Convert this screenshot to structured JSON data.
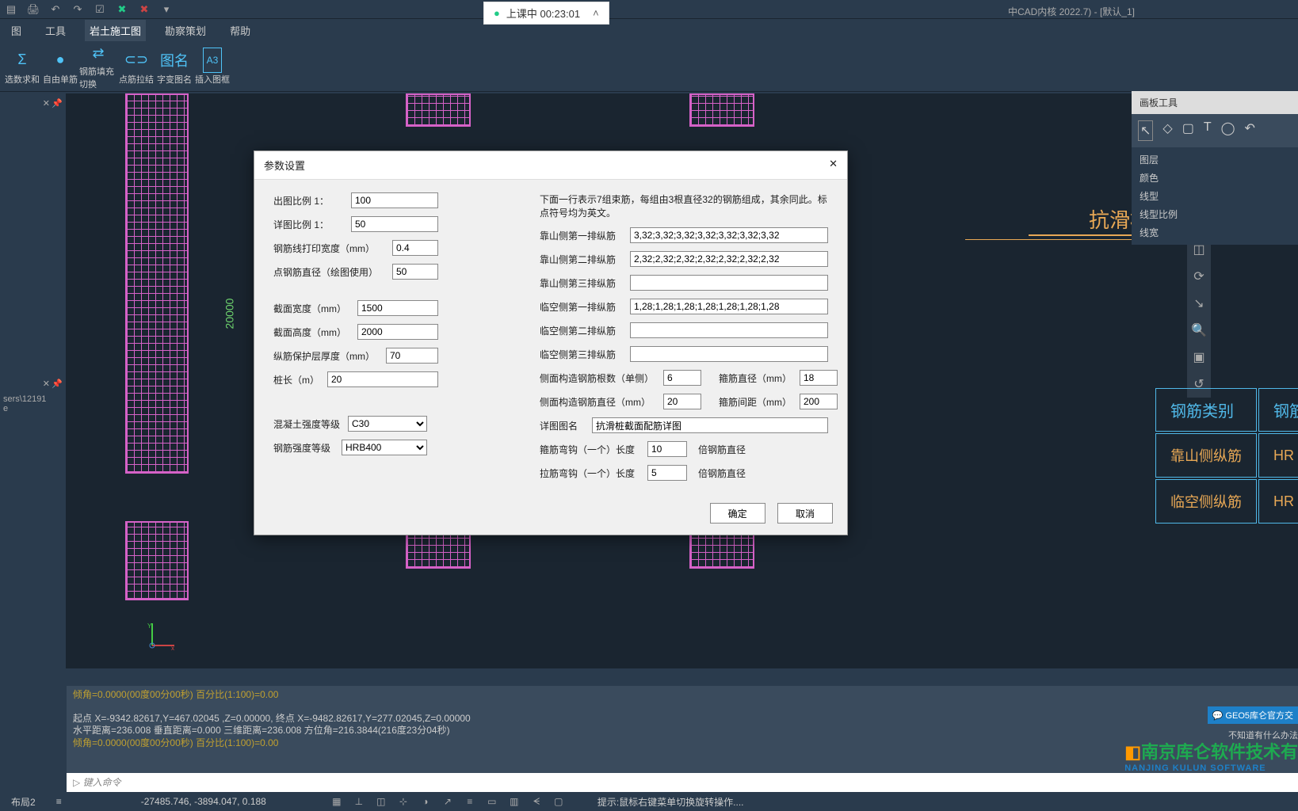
{
  "title_bar": "中CAD内核 2022.7)  - [默认_1]",
  "recording": {
    "text": "上课中 00:23:01"
  },
  "menu": [
    "图",
    "工具",
    "岩土施工图",
    "勘察策划",
    "帮助"
  ],
  "ribbon": [
    {
      "icon": "Σ",
      "label": "选数求和"
    },
    {
      "icon": "●",
      "label": "自由单筋"
    },
    {
      "icon": "⇄",
      "label": "钢筋填充切换"
    },
    {
      "icon": "⊂⊃",
      "label": "点筋拉结"
    },
    {
      "icon": "图名",
      "label": "字变图名"
    },
    {
      "icon": "A3",
      "label": "插入图框"
    }
  ],
  "left_panel_path": "sers\\12191\ne",
  "dim_value": "20000",
  "dialog": {
    "title": "参数设置",
    "hint": "下面一行表示7组束筋，每组由3根直径32的钢筋组成，其余同此。标点符号均为英文。",
    "left": {
      "scale1": {
        "label": "出图比例 1：",
        "value": "100"
      },
      "scale2": {
        "label": "详图比例 1：",
        "value": "50"
      },
      "linew": {
        "label": "钢筋线打印宽度（mm）",
        "value": "0.4"
      },
      "dotd": {
        "label": "点钢筋直径（绘图使用）",
        "value": "50"
      },
      "secw": {
        "label": "截面宽度（mm）",
        "value": "1500"
      },
      "sech": {
        "label": "截面高度（mm）",
        "value": "2000"
      },
      "cover": {
        "label": "纵筋保护层厚度（mm）",
        "value": "70"
      },
      "plen": {
        "label": "桩长（m）",
        "value": "20"
      },
      "concrete": {
        "label": "混凝土强度等级",
        "value": "C30"
      },
      "rebar": {
        "label": "钢筋强度等级",
        "value": "HRB400"
      }
    },
    "right": {
      "m1": {
        "label": "靠山侧第一排纵筋",
        "value": "3,32;3,32;3,32;3,32;3,32;3,32;3,32"
      },
      "m2": {
        "label": "靠山侧第二排纵筋",
        "value": "2,32;2,32;2,32;2,32;2,32;2,32;2,32"
      },
      "m3": {
        "label": "靠山侧第三排纵筋",
        "value": ""
      },
      "f1": {
        "label": "临空侧第一排纵筋",
        "value": "1,28;1,28;1,28;1,28;1,28;1,28;1,28"
      },
      "f2": {
        "label": "临空侧第二排纵筋",
        "value": ""
      },
      "f3": {
        "label": "临空侧第三排纵筋",
        "value": ""
      },
      "sidecount": {
        "label": "侧面构造钢筋根数（单侧）",
        "value": "6"
      },
      "sided": {
        "label": "侧面构造钢筋直径（mm）",
        "value": "20"
      },
      "stird": {
        "label": "箍筋直径（mm）",
        "value": "18"
      },
      "stirspace": {
        "label": "箍筋间距（mm）",
        "value": "200"
      },
      "figname": {
        "label": "详图图名",
        "value": "抗滑桩截面配筋详图"
      },
      "hook1": {
        "label": "箍筋弯钩（一个）长度",
        "value": "10",
        "suffix": "倍钢筋直径"
      },
      "hook2": {
        "label": "拉筋弯钩（一个）长度",
        "value": "5",
        "suffix": "倍钢筋直径"
      }
    },
    "ok": "确定",
    "cancel": "取消"
  },
  "right_panel": {
    "title": "画板工具",
    "menu": [
      "图层",
      "颜色",
      "线型",
      "线型比例",
      "线宽"
    ]
  },
  "canvas_title": "抗滑桩截",
  "canvas_table": {
    "header": [
      "钢筋类别",
      "钢筋"
    ],
    "rows": [
      [
        "靠山侧纵筋",
        "HR"
      ],
      [
        "临空侧纵筋",
        "HR"
      ]
    ]
  },
  "console": [
    "倾角=0.0000(00度00分00秒)   百分比(1:100)=0.00",
    "起点 X=-9342.82617,Y=467.02045 ,Z=0.00000, 终点  X=-9482.82617,Y=277.02045,Z=0.00000",
    "水平距离=236.008    垂直距离=0.000    三维距离=236.008   方位角=216.3844(216度23分04秒)",
    "倾角=0.0000(00度00分00秒)   百分比(1:100)=0.00"
  ],
  "cmdline_placeholder": "键入命令",
  "status": {
    "layout": "布局2",
    "coords": "-27485.746, -3894.047, 0.188",
    "hint": "提示:鼠标右键菜单切换旋转操作...."
  },
  "watermark": {
    "l1": "南京库仑软件技术有",
    "l2": "NANJING KULUN SOFTWARE"
  },
  "geo5": "GEO5库仑官方交",
  "unknown": "不知道有什么办法"
}
